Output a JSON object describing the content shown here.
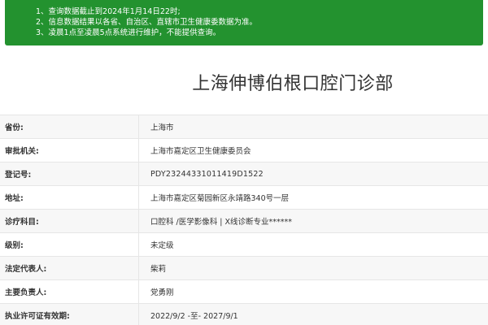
{
  "notice": {
    "lines": [
      "1、查询数据截止到2024年1月14日22时;",
      "2、信息数据结果以各省、自治区、直辖市卫生健康委数据为准。",
      "3、凌晨1点至凌晨5点系统进行维护，不能提供查询。"
    ]
  },
  "title": "上海伸博伯根口腔门诊部",
  "rows": [
    {
      "label": "省份:",
      "value": "上海市"
    },
    {
      "label": "审批机关:",
      "value": "上海市嘉定区卫生健康委员会"
    },
    {
      "label": "登记号:",
      "value": "PDY23244331011419D1522"
    },
    {
      "label": "地址:",
      "value": "上海市嘉定区菊园新区永靖路340号一层"
    },
    {
      "label": "诊疗科目:",
      "value": "口腔科 /医学影像科 | X线诊断专业******"
    },
    {
      "label": "级别:",
      "value": "未定级"
    },
    {
      "label": "法定代表人:",
      "value": "柴莉"
    },
    {
      "label": "主要负责人:",
      "value": "党勇刚"
    },
    {
      "label": "执业许可证有效期:",
      "value": "2022/9/2 -至- 2027/9/1"
    }
  ],
  "colors": {
    "notice_bg": "#23922f",
    "row_alt": "#f7f7f7",
    "border": "#e6e6e6"
  }
}
